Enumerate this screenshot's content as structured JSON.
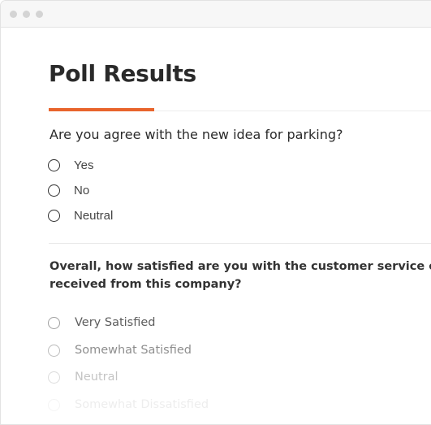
{
  "page": {
    "title": "Poll Results"
  },
  "theme": {
    "accent": "#e8642c"
  },
  "poll1": {
    "question": "Are you agree with the new idea for parking?",
    "options": [
      "Yes",
      "No",
      "Neutral"
    ]
  },
  "poll2": {
    "question_line1": "Overall, how satisfied are you with the customer service ex",
    "question_line2": "received from this company?",
    "options": [
      "Very Satisfied",
      "Somewhat Satisfied",
      "Neutral",
      "Somewhat Dissatisfied"
    ]
  }
}
